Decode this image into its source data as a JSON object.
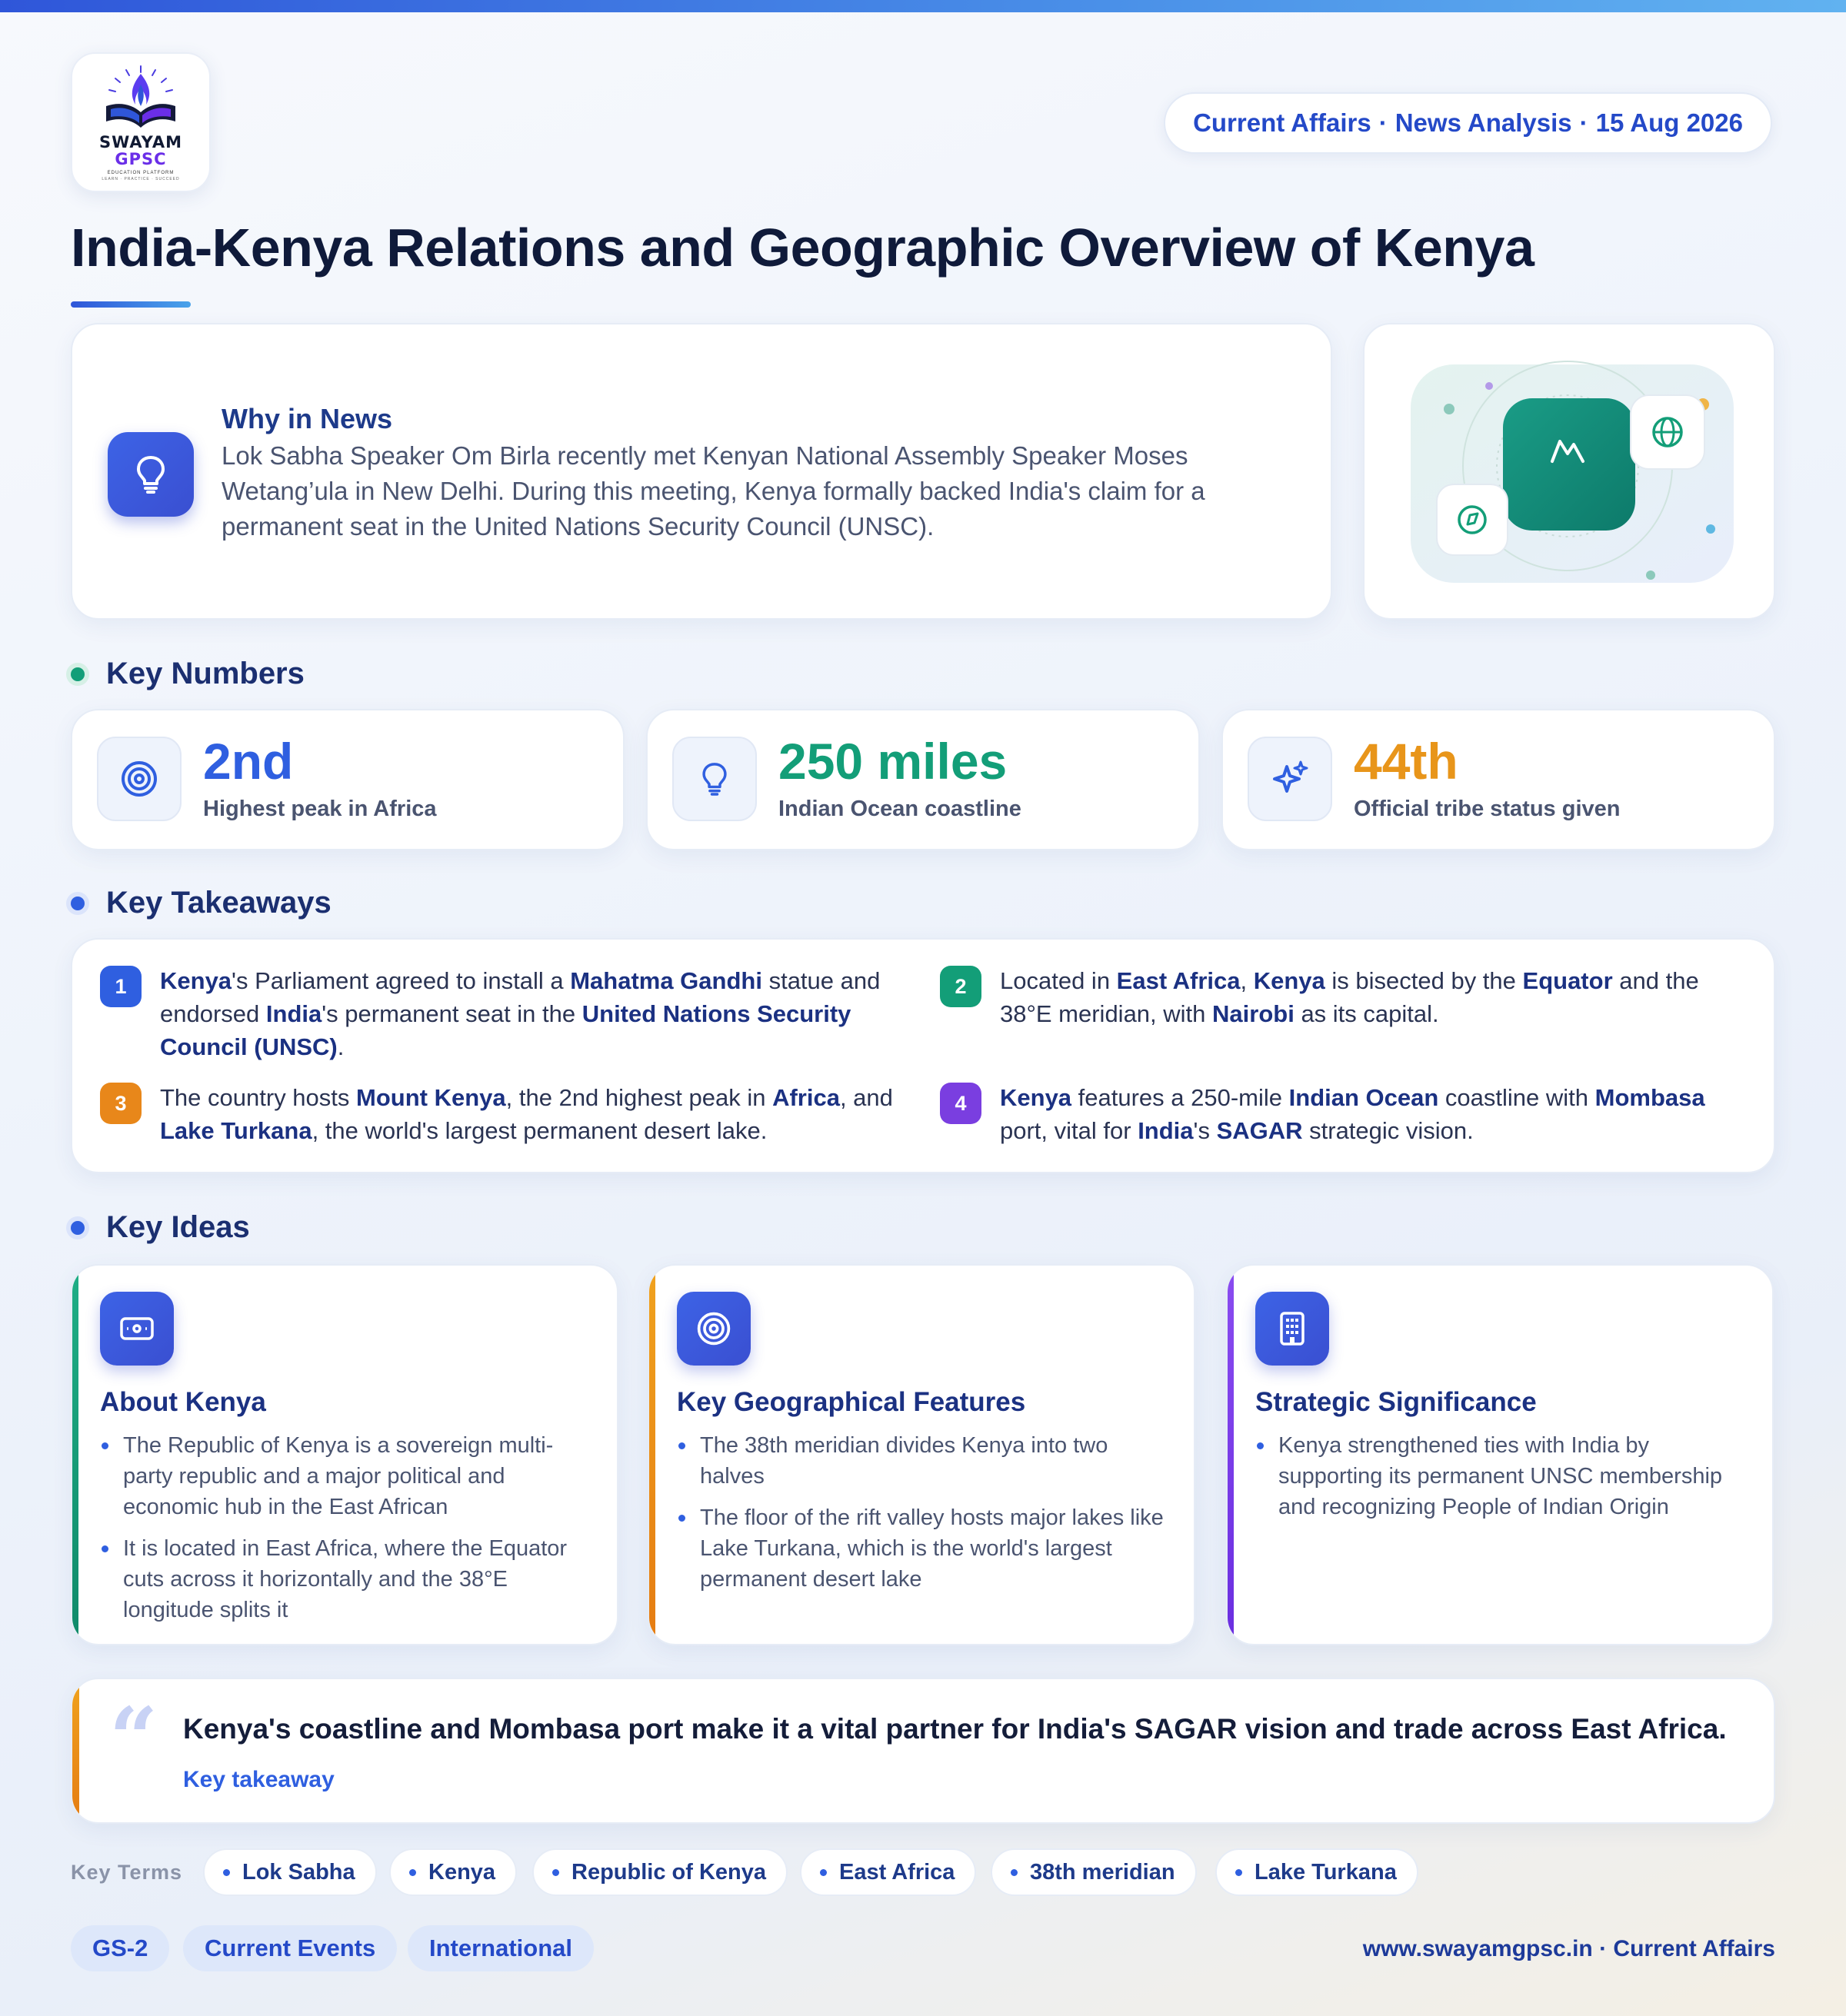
{
  "header": {
    "logo": {
      "name": "SWAYAM",
      "sub": "GPSC",
      "tagline": "EDUCATION PLATFORM",
      "motto": "LEARN · PRACTICE · SUCCEED"
    },
    "date_pill": {
      "section": "Current Affairs",
      "type": "News Analysis",
      "date": "15 Aug 2026"
    },
    "title": "India-Kenya Relations and Geographic Overview of Kenya"
  },
  "why_in_news": {
    "heading": "Why in News",
    "text": "Lok Sabha Speaker Om Birla recently met Kenyan National Assembly Speaker Moses Wetang’ula in New Delhi. During this meeting, Kenya formally backed India's claim for a permanent seat in the United Nations Security Council (UNSC).",
    "icon": "lightbulb-icon"
  },
  "key_numbers": {
    "heading": "Key Numbers",
    "items": [
      {
        "value": "2nd",
        "label": "Highest peak in Africa",
        "icon": "target-icon",
        "color": "#2f5fe0"
      },
      {
        "value": "250 miles",
        "label": "Indian Ocean coastline",
        "icon": "lightbulb-icon",
        "color": "#139e78"
      },
      {
        "value": "44th",
        "label": "Official tribe status given",
        "icon": "sparkle-icon",
        "color": "#e8951a"
      }
    ]
  },
  "key_takeaways": {
    "heading": "Key Takeaways",
    "colors": [
      "#2f5fe0",
      "#139e78",
      "#e8871a",
      "#7a3ee0"
    ],
    "items": [
      {
        "num": "1",
        "parts": [
          [
            "b",
            "Kenya"
          ],
          [
            "t",
            "'s Parliament agreed to install a "
          ],
          [
            "b",
            "Mahatma Gandhi"
          ],
          [
            "t",
            " statue and endorsed "
          ],
          [
            "b",
            "India"
          ],
          [
            "t",
            "'s permanent seat in the "
          ],
          [
            "b",
            "United Nations Security Council (UNSC)"
          ],
          [
            "t",
            "."
          ]
        ]
      },
      {
        "num": "2",
        "parts": [
          [
            "t",
            "Located in "
          ],
          [
            "b",
            "East Africa"
          ],
          [
            "t",
            ", "
          ],
          [
            "b",
            "Kenya"
          ],
          [
            "t",
            " is bisected by the "
          ],
          [
            "b",
            "Equator"
          ],
          [
            "t",
            " and the 38°E meridian, with "
          ],
          [
            "b",
            "Nairobi"
          ],
          [
            "t",
            " as its capital."
          ]
        ]
      },
      {
        "num": "3",
        "parts": [
          [
            "t",
            "The country hosts "
          ],
          [
            "b",
            "Mount Kenya"
          ],
          [
            "t",
            ", the 2nd highest peak in "
          ],
          [
            "b",
            "Africa"
          ],
          [
            "t",
            ", and "
          ],
          [
            "b",
            "Lake Turkana"
          ],
          [
            "t",
            ", the world's largest permanent desert lake."
          ]
        ]
      },
      {
        "num": "4",
        "parts": [
          [
            "b",
            "Kenya"
          ],
          [
            "t",
            " features a 250-mile "
          ],
          [
            "b",
            "Indian Ocean"
          ],
          [
            "t",
            " coastline with "
          ],
          [
            "b",
            "Mombasa"
          ],
          [
            "t",
            " port, vital for "
          ],
          [
            "b",
            "India"
          ],
          [
            "t",
            "'s "
          ],
          [
            "b",
            "SAGAR"
          ],
          [
            "t",
            " strategic vision."
          ]
        ]
      }
    ]
  },
  "key_ideas": {
    "heading": "Key Ideas",
    "items": [
      {
        "title": "About Kenya",
        "icon": "id-card-icon",
        "accent": "#139e78",
        "points": [
          "The Republic of Kenya is a sovereign multi-party republic and a major political and economic hub in the East African",
          "It is located in East Africa, where the Equator cuts across it horizontally and the 38°E longitude splits it"
        ]
      },
      {
        "title": "Key Geographical Features",
        "icon": "target-icon",
        "accent": "#e8951a",
        "points": [
          "The 38th meridian divides Kenya into two halves",
          "The floor of the rift valley hosts major lakes like Lake Turkana, which is the world's largest permanent desert lake"
        ]
      },
      {
        "title": "Strategic Significance",
        "icon": "building-icon",
        "accent": "#7a3ee0",
        "points": [
          "Kenya strengthened ties with India by supporting its permanent UNSC membership and recognizing People of Indian Origin"
        ]
      }
    ]
  },
  "quote": {
    "mark": "“",
    "text": "Kenya's coastline and Mombasa port make it a vital partner for India's SAGAR vision and trade across East Africa.",
    "source": "Key takeaway"
  },
  "key_terms": {
    "label": "Key Terms",
    "items": [
      "Lok Sabha",
      "Kenya",
      "Republic of Kenya",
      "East Africa",
      "38th meridian",
      "Lake Turkana"
    ]
  },
  "footer": {
    "tags": [
      "GS-2",
      "Current Events",
      "International"
    ],
    "url": "www.swayamgpsc.in · Current Affairs"
  }
}
